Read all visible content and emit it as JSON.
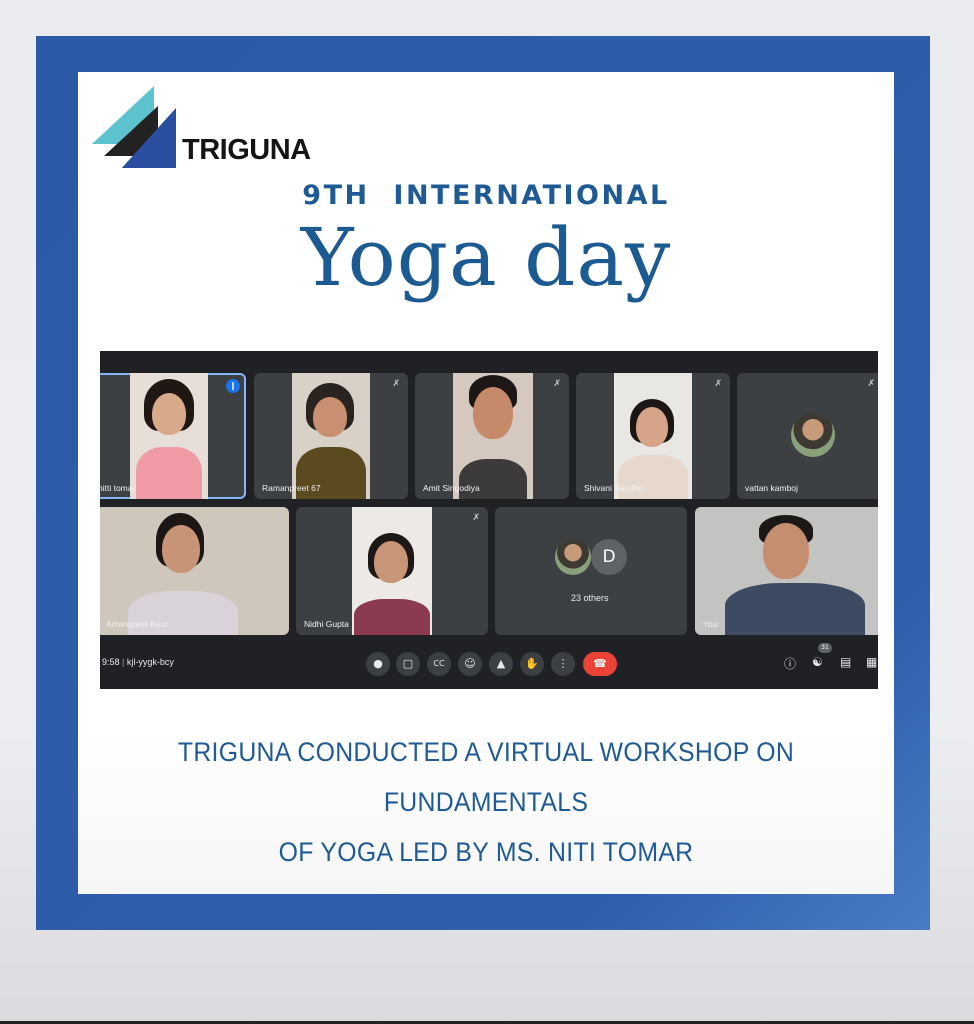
{
  "logo": {
    "text": "TRIGUNA"
  },
  "heading": {
    "subtitle": "9TH  INTERNATIONAL",
    "title": "Yoga day"
  },
  "meet": {
    "participants_row1": [
      {
        "name": "nitti tomar",
        "speaking": true
      },
      {
        "name": "Ramanpreet 67",
        "muted": true
      },
      {
        "name": "Amit Singodiya",
        "muted": true
      },
      {
        "name": "Shivani Sandhu",
        "muted": true
      },
      {
        "name": "vattan kamboj",
        "muted": true
      }
    ],
    "participants_row2": [
      {
        "name": "Amanpreet Kaur",
        "muted": true
      },
      {
        "name": "Nidhi Gupta",
        "muted": true
      },
      {
        "name": "D",
        "others": "23 others"
      },
      {
        "name": "You"
      }
    ],
    "time": "9:58",
    "meeting_code": "kjl-yygk-bcy",
    "participant_count": "31",
    "icons": {
      "mic": "mic-icon",
      "camera": "camera-icon",
      "captions": "captions-icon",
      "emoji": "emoji-icon",
      "present": "present-icon",
      "hand": "raise-hand-icon",
      "more": "more-icon",
      "end": "end-call-icon",
      "info": "info-icon",
      "people": "people-icon",
      "chat": "chat-icon"
    },
    "colors": {
      "end_call": "#ea4335",
      "active_speaker": "#1a73e8"
    }
  },
  "caption": {
    "line1": "TRIGUNA CONDUCTED A VIRTUAL WORKSHOP ON FUNDAMENTALS",
    "line2": "OF YOGA LED BY MS. NITI TOMAR"
  },
  "colors": {
    "frame": "#2c5aa6",
    "heading": "#1c5a92"
  }
}
